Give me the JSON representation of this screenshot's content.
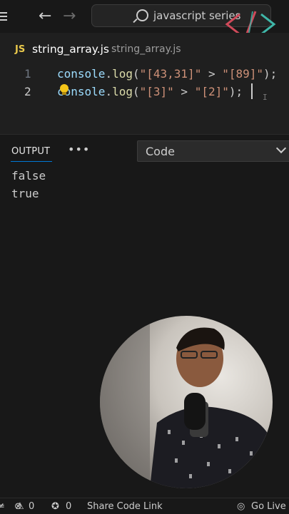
{
  "titlebar": {
    "search_text": "javascript series"
  },
  "tab": {
    "badge": "JS",
    "filename": "string_array.js",
    "path": "string_array.js"
  },
  "editor": {
    "lines": [
      {
        "number": "1",
        "obj": "console",
        "dot": ".",
        "fn": "log",
        "open": "(",
        "left": "\"[43,31]\"",
        "op": " > ",
        "right": "\"[89]\"",
        "close": ");"
      },
      {
        "number": "2",
        "obj": "console",
        "dot": ".",
        "fn": "log",
        "open": "(",
        "left": "\"[3]\"",
        "op": " > ",
        "right": "\"[2]\"",
        "close": ");"
      }
    ]
  },
  "panel": {
    "tab_label": "OUTPUT",
    "more_label": "•••",
    "channel_selected": "Code",
    "output_lines": [
      "false",
      "true"
    ]
  },
  "statusbar": {
    "errors_count": "0",
    "warnings_count": "0",
    "ports_count": "0",
    "share_label": "Share Code Link",
    "golive_label": "Go Live"
  },
  "colors": {
    "accent": "#0078d4",
    "js_badge": "#e8c84b",
    "string": "#ce9178",
    "function": "#dcdcaa",
    "object": "#9cdcfe"
  }
}
